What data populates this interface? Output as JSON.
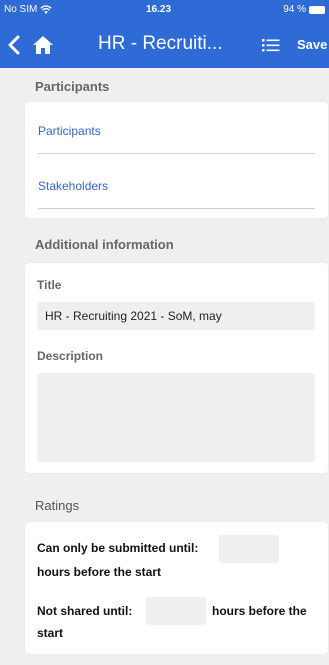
{
  "status_bar": {
    "carrier": "No SIM",
    "time": "16.23",
    "battery": "94 %"
  },
  "nav": {
    "title": "HR - Recruiti...",
    "save_label": "Save"
  },
  "participants_section": {
    "header": "Participants",
    "items": [
      {
        "label": "Participants"
      },
      {
        "label": "Stakeholders"
      }
    ]
  },
  "additional_section": {
    "header": "Additional information",
    "title_label": "Title",
    "title_value": "HR - Recruiting 2021 - SoM, may",
    "description_label": "Description",
    "description_value": ""
  },
  "ratings_section": {
    "header": "Ratings",
    "submit_prefix": "Can only be submitted until:",
    "submit_suffix": "hours before the start",
    "submit_value": "",
    "shared_prefix": "Not shared until:",
    "shared_suffix": "hours before the",
    "shared_suffix_2": "start",
    "shared_value": ""
  },
  "colors": {
    "header_bg": "#2e6bd6",
    "link": "#3366cc",
    "page_bg": "#efefef"
  }
}
